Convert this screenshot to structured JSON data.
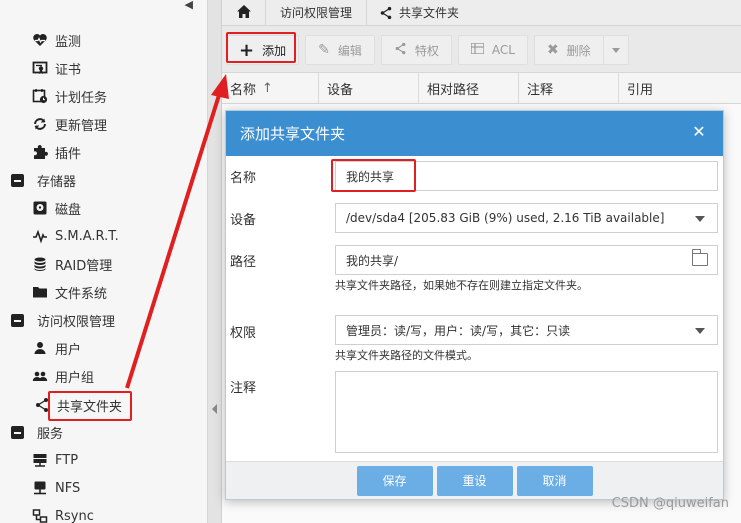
{
  "sidebar": {
    "items": [
      {
        "label": "监测",
        "icon": "heartbeat-icon",
        "type": "child"
      },
      {
        "label": "证书",
        "icon": "certificate-icon",
        "type": "child"
      },
      {
        "label": "计划任务",
        "icon": "calendar-icon",
        "type": "child"
      },
      {
        "label": "更新管理",
        "icon": "refresh-icon",
        "type": "child"
      },
      {
        "label": "插件",
        "icon": "puzzle-icon",
        "type": "child"
      },
      {
        "label": "存储器",
        "icon": "minus-box-icon",
        "type": "group"
      },
      {
        "label": "磁盘",
        "icon": "disk-icon",
        "type": "child"
      },
      {
        "label": "S.M.A.R.T.",
        "icon": "pulse-icon",
        "type": "child"
      },
      {
        "label": "RAID管理",
        "icon": "database-icon",
        "type": "child"
      },
      {
        "label": "文件系统",
        "icon": "folder-icon",
        "type": "child"
      },
      {
        "label": "访问权限管理",
        "icon": "minus-box-icon",
        "type": "group"
      },
      {
        "label": "用户",
        "icon": "user-icon",
        "type": "child"
      },
      {
        "label": "用户组",
        "icon": "users-icon",
        "type": "child"
      },
      {
        "label": "共享文件夹",
        "icon": "share-icon",
        "type": "child"
      },
      {
        "label": "服务",
        "icon": "minus-box-icon",
        "type": "group"
      },
      {
        "label": "FTP",
        "icon": "server-icon",
        "type": "child"
      },
      {
        "label": "NFS",
        "icon": "network-icon",
        "type": "child"
      },
      {
        "label": "Rsync",
        "icon": "sync-icon",
        "type": "child"
      }
    ]
  },
  "breadcrumb": {
    "items": [
      "访问权限管理",
      "共享文件夹"
    ]
  },
  "toolbar": {
    "add": "添加",
    "edit": "编辑",
    "privileges": "特权",
    "acl": "ACL",
    "delete": "删除"
  },
  "grid": {
    "columns": [
      "名称",
      "设备",
      "相对路径",
      "注释",
      "引用"
    ],
    "sort_indicator": "↑"
  },
  "dialog": {
    "title": "添加共享文件夹",
    "fields": {
      "name": {
        "label": "名称",
        "value": "我的共享"
      },
      "device": {
        "label": "设备",
        "value": "/dev/sda4 [205.83 GiB (9%) used, 2.16 TiB available]"
      },
      "path": {
        "label": "路径",
        "value": "我的共享/",
        "hint": "共享文件夹路径，如果她不存在则建立指定文件夹。"
      },
      "permissions": {
        "label": "权限",
        "value": "管理员：读/写，用户：读/写，其它：只读",
        "hint": "共享文件夹路径的文件模式。"
      },
      "comment": {
        "label": "注释",
        "value": ""
      }
    },
    "buttons": {
      "save": "保存",
      "reset": "重设",
      "cancel": "取消"
    }
  },
  "watermark": "CSDN @qiuweifan",
  "colors": {
    "accent": "#3b8fd0",
    "button": "#6aaee5",
    "highlight": "#e02020"
  }
}
